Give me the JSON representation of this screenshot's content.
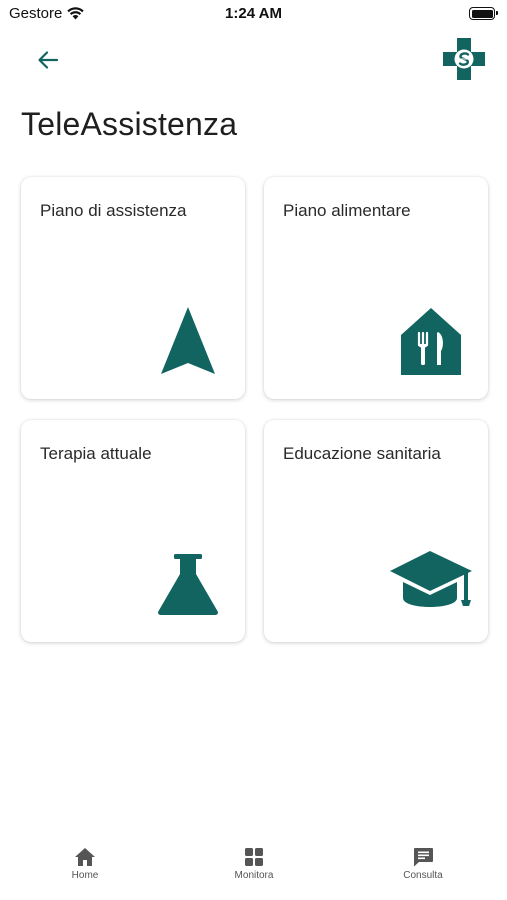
{
  "status_bar": {
    "carrier": "Gestore",
    "time": "1:24 AM",
    "icons": [
      "wifi-icon",
      "battery-icon"
    ]
  },
  "header": {
    "back_icon": "arrow-left-icon",
    "logo_icon": "medical-cross-logo",
    "title": "TeleAssistenza"
  },
  "colors": {
    "accent": "#126461",
    "text": "#222222",
    "nav_icon": "#555555"
  },
  "cards": [
    {
      "label": "Piano di assistenza",
      "icon": "navigation-arrow-icon"
    },
    {
      "label": "Piano alimentare",
      "icon": "restaurant-house-icon"
    },
    {
      "label": "Terapia attuale",
      "icon": "flask-icon"
    },
    {
      "label": "Educazione sanitaria",
      "icon": "graduation-cap-icon"
    }
  ],
  "bottom_nav": {
    "items": [
      {
        "label": "Home",
        "icon": "home-icon"
      },
      {
        "label": "Monitora",
        "icon": "grid-icon"
      },
      {
        "label": "Consulta",
        "icon": "chat-icon"
      }
    ]
  }
}
